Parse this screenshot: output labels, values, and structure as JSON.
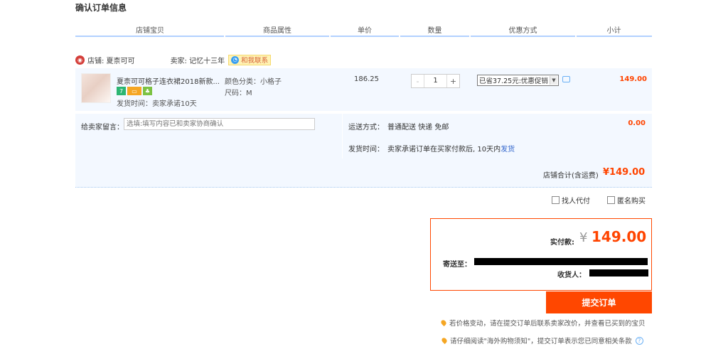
{
  "page": {
    "title": "确认订单信息"
  },
  "table_header": {
    "columns": [
      "店铺宝贝",
      "商品属性",
      "单价",
      "数量",
      "优惠方式",
      "小计"
    ]
  },
  "shop": {
    "icon": "store-icon",
    "label": "店铺: 夏柰可可",
    "seller_label": "卖家: 记忆十三年",
    "contact_label": "和我联系"
  },
  "item": {
    "name": "夏柰可可格子连衣裙2018新款...",
    "ship_time": "发货时间：卖家承诺10天",
    "attr_color": "颜色分类：小格子",
    "attr_size": "尺码：M",
    "price": "186.25",
    "quantity": "1",
    "qty_minus": "-",
    "qty_plus": "+",
    "promo": "已省37.25元:优惠促销",
    "subtotal": "149.00"
  },
  "message": {
    "label": "给卖家留言：",
    "placeholder": "选填:填写内容已和卖家协商确认"
  },
  "shipping": {
    "method_label": "运送方式：",
    "method_value": "普通配送 快递 免邮",
    "fee": "0.00",
    "time_label": "发货时间：",
    "time_value": "卖家承诺订单在买家付款后, 10天内",
    "time_link": "发货"
  },
  "shop_total": {
    "label": "店铺合计(含运费)",
    "value": "¥149.00"
  },
  "options": {
    "proxy_pay": "找人代付",
    "anonymous": "匿名购买"
  },
  "payment": {
    "paid_label": "实付款:",
    "currency": "¥",
    "paid_value": "149.00",
    "address_label": "寄送至：",
    "receiver_label": "收货人："
  },
  "submit_label": "提交订单",
  "notices": [
    "若价格变动，请在提交订单后联系卖家改价，并查看已买到的宝贝",
    "请仔细阅读\"海外购物须知\"，提交订单表示您已同意相关条款"
  ],
  "colors": {
    "accent": "#ff4700",
    "price_red": "#ff4400",
    "header_line": "#b2d1ff",
    "row_bg": "#f3f8ff"
  }
}
